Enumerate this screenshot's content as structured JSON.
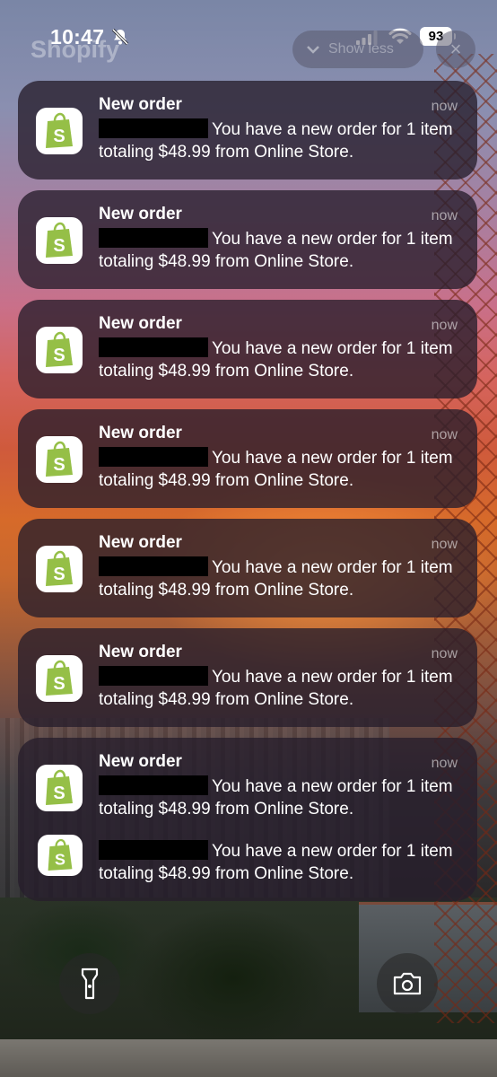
{
  "status_bar": {
    "time": "10:47",
    "battery": "93",
    "icons": [
      "bell-slash-icon",
      "signal-icon",
      "wifi-icon",
      "battery-icon"
    ]
  },
  "header": {
    "app_name": "Shopify",
    "show_less_label": "Show less",
    "close_label": "×"
  },
  "notifications": [
    {
      "title": "New order",
      "time": "now",
      "body": "You have a new order for 1 item totaling $48.99 from Online Store."
    },
    {
      "title": "New order",
      "time": "now",
      "body": "You have a new order for 1 item totaling $48.99 from Online Store."
    },
    {
      "title": "New order",
      "time": "now",
      "body": "You have a new order for 1 item totaling $48.99 from Online Store."
    },
    {
      "title": "New order",
      "time": "now",
      "body": "You have a new order for 1 item totaling $48.99 from Online Store."
    },
    {
      "title": "New order",
      "time": "now",
      "body": "You have a new order for 1 item totaling $48.99 from Online Store."
    },
    {
      "title": "New order",
      "time": "now",
      "body": "You have a new order for 1 item totaling $48.99 from Online Store."
    },
    {
      "title": "New order",
      "time": "now",
      "body": "You have a new order for 1 item totaling $48.99 from Online Store."
    },
    {
      "title": "",
      "time": "",
      "body": "You have a new order for 1 item totaling $48.99 from Online Store."
    }
  ],
  "bottom": {
    "left_icon": "flashlight-icon",
    "right_icon": "camera-icon"
  },
  "colors": {
    "shopify_green": "#95BF47",
    "notification_bg": "#261E2C"
  }
}
